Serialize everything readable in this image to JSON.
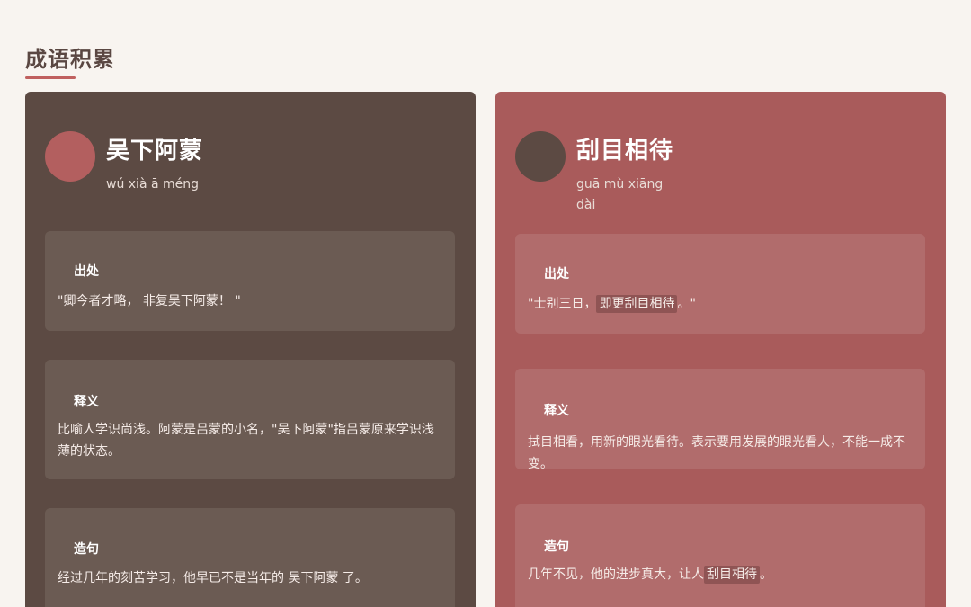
{
  "section_title": "成语积累",
  "cards": [
    {
      "idiom": "吴下阿蒙",
      "pinyin": "wú xià ā méng",
      "source_label": "出处",
      "source_text": "\"卿今者才略， 非复吴下阿蒙！ \"",
      "meaning_label": "释义",
      "meaning_text": "比喻人学识尚浅。阿蒙是吕蒙的小名，\"吴下阿蒙\"指吕蒙原来学识浅薄的状态。",
      "example_label": "造句",
      "example_text": "经过几年的刻苦学习，他早已不是当年的 吴下阿蒙 了。"
    },
    {
      "idiom": "刮目相待",
      "pinyin": "guā mù xiāng dài",
      "source_label": "出处",
      "source_before": "\"士别三日，",
      "source_highlight": "即更刮目相待",
      "source_after": "。\"",
      "meaning_label": "释义",
      "meaning_text": "拭目相看，用新的眼光看待。表示要用发展的眼光看人，不能一成不变。",
      "example_label": "造句",
      "example_before": "几年不见，他的进步真大，让人",
      "example_highlight": "刮目相待",
      "example_after": "。"
    }
  ],
  "colors": {
    "background": "#f8f4f0",
    "left_card": "#5c4a43",
    "right_card": "#a95b5b",
    "accent": "#c0605f"
  }
}
